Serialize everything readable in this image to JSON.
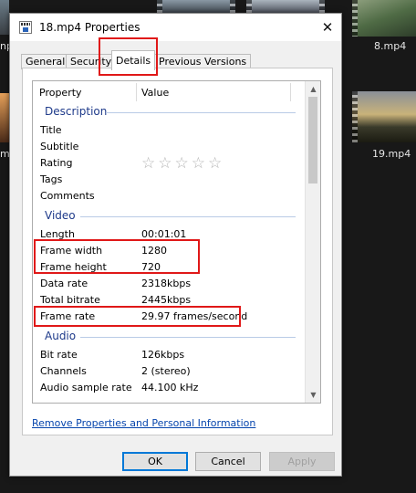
{
  "background": {
    "labels": {
      "file_right_top": "8.mp4",
      "file_right_mid": "19.mp4",
      "left_partial_top": "np",
      "left_partial_mid": "mp"
    }
  },
  "dialog": {
    "title": "18.mp4 Properties",
    "close_glyph": "✕",
    "tabs": [
      "General",
      "Security",
      "Details",
      "Previous Versions"
    ],
    "active_tab": "Details",
    "header": {
      "property": "Property",
      "value": "Value"
    },
    "sections": {
      "description": {
        "label": "Description",
        "rows": [
          {
            "k": "Title",
            "v": ""
          },
          {
            "k": "Subtitle",
            "v": ""
          },
          {
            "k": "Rating",
            "v": "☆☆☆☆☆"
          },
          {
            "k": "Tags",
            "v": ""
          },
          {
            "k": "Comments",
            "v": ""
          }
        ]
      },
      "video": {
        "label": "Video",
        "rows": [
          {
            "k": "Length",
            "v": "00:01:01"
          },
          {
            "k": "Frame width",
            "v": "1280"
          },
          {
            "k": "Frame height",
            "v": "720"
          },
          {
            "k": "Data rate",
            "v": "2318kbps"
          },
          {
            "k": "Total bitrate",
            "v": "2445kbps"
          },
          {
            "k": "Frame rate",
            "v": "29.97 frames/second"
          }
        ]
      },
      "audio": {
        "label": "Audio",
        "rows": [
          {
            "k": "Bit rate",
            "v": "126kbps"
          },
          {
            "k": "Channels",
            "v": "2 (stereo)"
          },
          {
            "k": "Audio sample rate",
            "v": "44.100 kHz"
          }
        ]
      }
    },
    "link": "Remove Properties and Personal Information",
    "buttons": {
      "ok": "OK",
      "cancel": "Cancel",
      "apply": "Apply"
    }
  }
}
